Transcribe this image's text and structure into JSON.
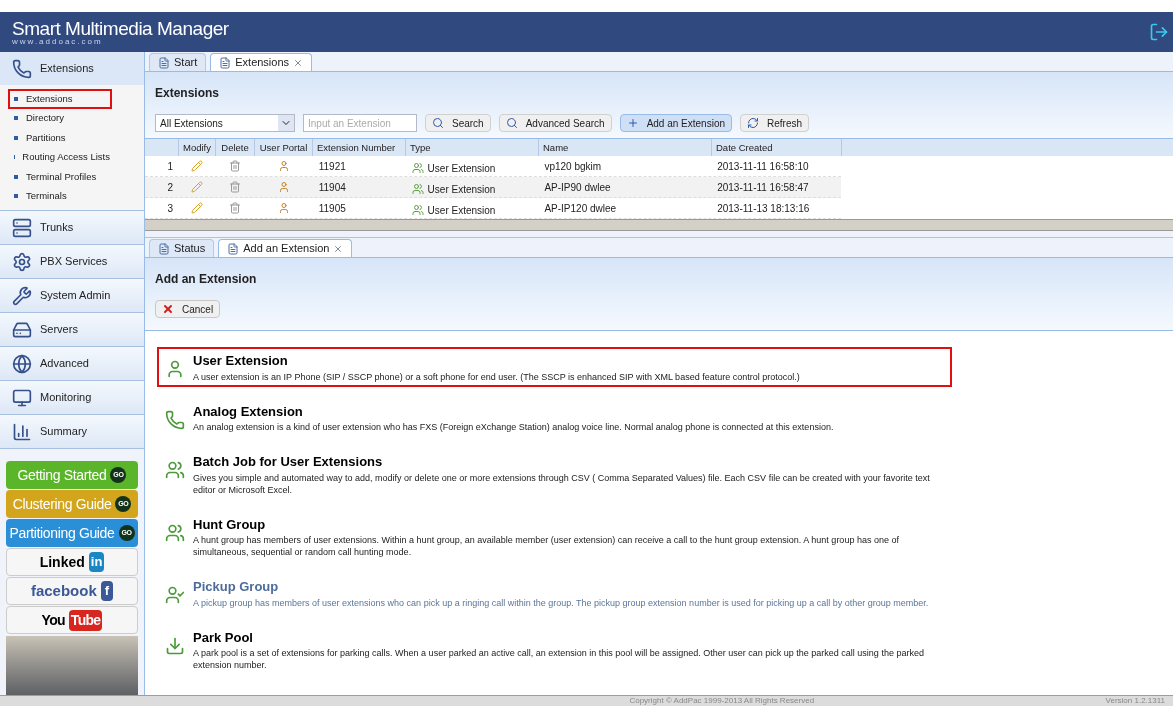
{
  "header": {
    "title": "Smart Multimedia Manager",
    "subtitle": "www.addoac.com"
  },
  "sidebar": {
    "sections": [
      {
        "label": "Extensions",
        "expanded": true,
        "items": [
          {
            "label": "Extensions",
            "highlighted": true
          },
          {
            "label": "Directory",
            "highlighted": false
          },
          {
            "label": "Partitions",
            "highlighted": false
          },
          {
            "label": "Routing Access Lists",
            "highlighted": false
          },
          {
            "label": "Terminal Profiles",
            "highlighted": false
          },
          {
            "label": "Terminals",
            "highlighted": false
          }
        ]
      },
      {
        "label": "Trunks",
        "expanded": false
      },
      {
        "label": "PBX Services",
        "expanded": false
      },
      {
        "label": "System Admin",
        "expanded": false
      },
      {
        "label": "Servers",
        "expanded": false
      },
      {
        "label": "Advanced",
        "expanded": false
      },
      {
        "label": "Monitoring",
        "expanded": false
      },
      {
        "label": "Summary",
        "expanded": false
      }
    ],
    "guides": [
      {
        "label": "Getting Started",
        "badge": "GO",
        "color": "#5bb52a"
      },
      {
        "label": "Clustering Guide",
        "badge": "GO",
        "color": "#d2a51c"
      },
      {
        "label": "Partitioning Guide",
        "badge": "GO",
        "color": "#2b8fd8"
      }
    ],
    "social": [
      {
        "kind": "linkedin",
        "text": "Linked",
        "badge": "in"
      },
      {
        "kind": "facebook",
        "text": "facebook",
        "badge": "f"
      },
      {
        "kind": "youtube",
        "text": "You",
        "badge": "Tube"
      }
    ]
  },
  "top_panel": {
    "tabs": [
      {
        "label": "Start",
        "selected": false,
        "closable": false
      },
      {
        "label": "Extensions",
        "selected": true,
        "closable": true
      }
    ],
    "title": "Extensions",
    "filter": {
      "value": "All Extensions"
    },
    "search": {
      "placeholder": "Input an Extension"
    },
    "buttons": [
      {
        "label": "Search",
        "selected": false
      },
      {
        "label": "Advanced Search",
        "selected": false
      },
      {
        "label": "Add an Extension",
        "selected": true
      },
      {
        "label": "Refresh",
        "selected": false
      }
    ],
    "table": {
      "columns": [
        "Modify",
        "Delete",
        "User Portal",
        "Extension Number",
        "Type",
        "Name",
        "Date Created"
      ],
      "rows": [
        {
          "number": "1",
          "extension": "11921",
          "type": "User Extension",
          "name": "vp120 bgkim",
          "date": "2013-11-11 16:58:10"
        },
        {
          "number": "2",
          "extension": "11904",
          "type": "User Extension",
          "name": "AP-IP90 dwlee",
          "date": "2013-11-11 16:58:47"
        },
        {
          "number": "3",
          "extension": "11905",
          "type": "User Extension",
          "name": "AP-IP120 dwlee",
          "date": "2013-11-13 18:13:16"
        }
      ]
    }
  },
  "bottom_panel": {
    "tabs": [
      {
        "label": "Status",
        "selected": false,
        "closable": false
      },
      {
        "label": "Add an Extension",
        "selected": true,
        "closable": true
      }
    ],
    "title": "Add an Extension",
    "cancel": "Cancel",
    "options": [
      {
        "title": "User Extension",
        "description": "A user extension is an IP Phone (SIP / SSCP phone) or a soft phone for end user. (The SSCP is enhanced SIP with XML based feature control protocol.)",
        "highlighted": true,
        "hovered": false
      },
      {
        "title": "Analog Extension",
        "description": "An analog extension is a kind of user extension who has FXS (Foreign eXchange Station) analog voice line. Normal analog phone is connected at this extension.",
        "highlighted": false,
        "hovered": false
      },
      {
        "title": "Batch Job for User Extensions",
        "description": "Gives you simple and automated way to add, modify or delete one or more extensions through CSV ( Comma Separated Values) file. Each CSV file can be created with your favorite text editor or Microsoft Excel.",
        "highlighted": false,
        "hovered": false
      },
      {
        "title": "Hunt Group",
        "description": "A hunt group has members of user extensions. Within a hunt group, an available member (user extension) can receive a call to the hunt group extension. A hunt group has one of simultaneous, sequential or random call hunting mode.",
        "highlighted": false,
        "hovered": false
      },
      {
        "title": "Pickup Group",
        "description": "A pickup group has members of user extensions who can pick up a ringing call within the group. The pickup group extension number is used for picking up a call by other group member.",
        "highlighted": false,
        "hovered": true
      },
      {
        "title": "Park Pool",
        "description": "A park pool is a set of extensions for parking calls. When a user parked an active call, an extension in this pool will be assigned. Other user can pick up the parked call using the parked extension number.",
        "highlighted": false,
        "hovered": false
      }
    ]
  },
  "footer": {
    "copyright": "Copyright © AddPac 1999-2013 All Rights Reserved",
    "version": "Version 1.2.1311"
  }
}
